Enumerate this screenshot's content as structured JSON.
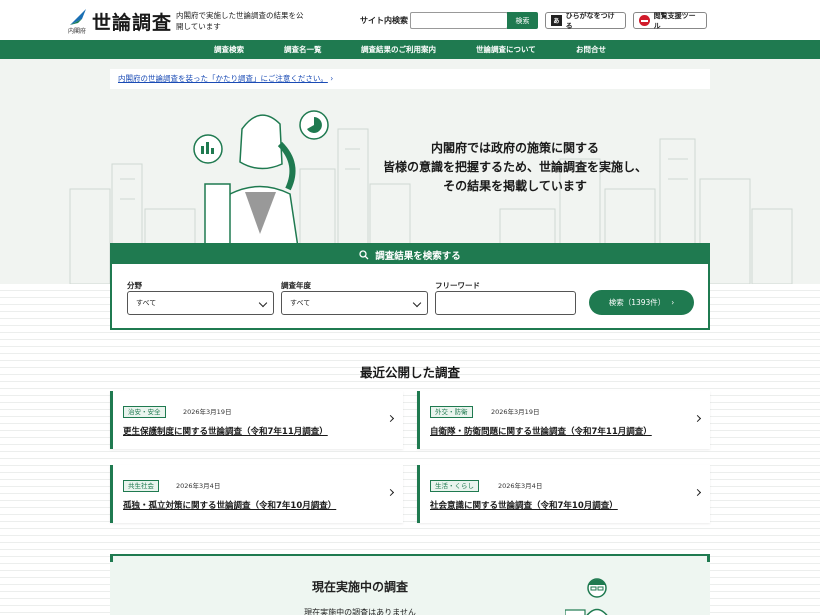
{
  "header": {
    "logo_title": "世論調査",
    "logo_gov": "内閣府",
    "description": "内閣府で実施した世論調査の結果を公開しています",
    "site_search_label": "サイト内検索",
    "site_search_button": "検索",
    "hiragana_button": "ひらがなをつける",
    "support_tool_button": "閲覧支援ツール"
  },
  "nav": {
    "items": [
      "調査検索",
      "調査名一覧",
      "調査結果のご利用案内",
      "世論調査について",
      "お問合せ"
    ]
  },
  "notice": {
    "text": "内閣府の世論調査を装った「かたり調査」にご注意ください。"
  },
  "hero": {
    "line1": "内閣府では政府の施策に関する",
    "line2": "皆様の意識を把握するため、世論調査を実施し、",
    "line3": "その結果を掲載しています"
  },
  "search": {
    "heading": "調査結果を検索する",
    "field_label": "分野",
    "field_value": "すべて",
    "year_label": "調査年度",
    "year_value": "すべて",
    "free_label": "フリーワード",
    "button": "検索（1393件）"
  },
  "recent": {
    "title": "最近公開した調査",
    "items": [
      {
        "badge": "治安・安全",
        "date": "2026年3月19日",
        "title": "更生保護制度に関する世論調査（令和7年11月調査）"
      },
      {
        "badge": "外交・防衛",
        "date": "2026年3月19日",
        "title": "自衛隊・防衛問題に関する世論調査（令和7年11月調査）"
      },
      {
        "badge": "共生社会",
        "date": "2026年3月4日",
        "title": "孤独・孤立対策に関する世論調査（令和7年10月調査）"
      },
      {
        "badge": "生活・くらし",
        "date": "2026年3月4日",
        "title": "社会意識に関する世論調査（令和7年10月調査）"
      }
    ]
  },
  "ongoing": {
    "title": "現在実施中の調査",
    "subtitle": "現在実施中の調査はありません"
  },
  "colors": {
    "brand_green": "#1f7a50",
    "link_blue": "#1a4bb5",
    "alert_red": "#d11a2a"
  }
}
